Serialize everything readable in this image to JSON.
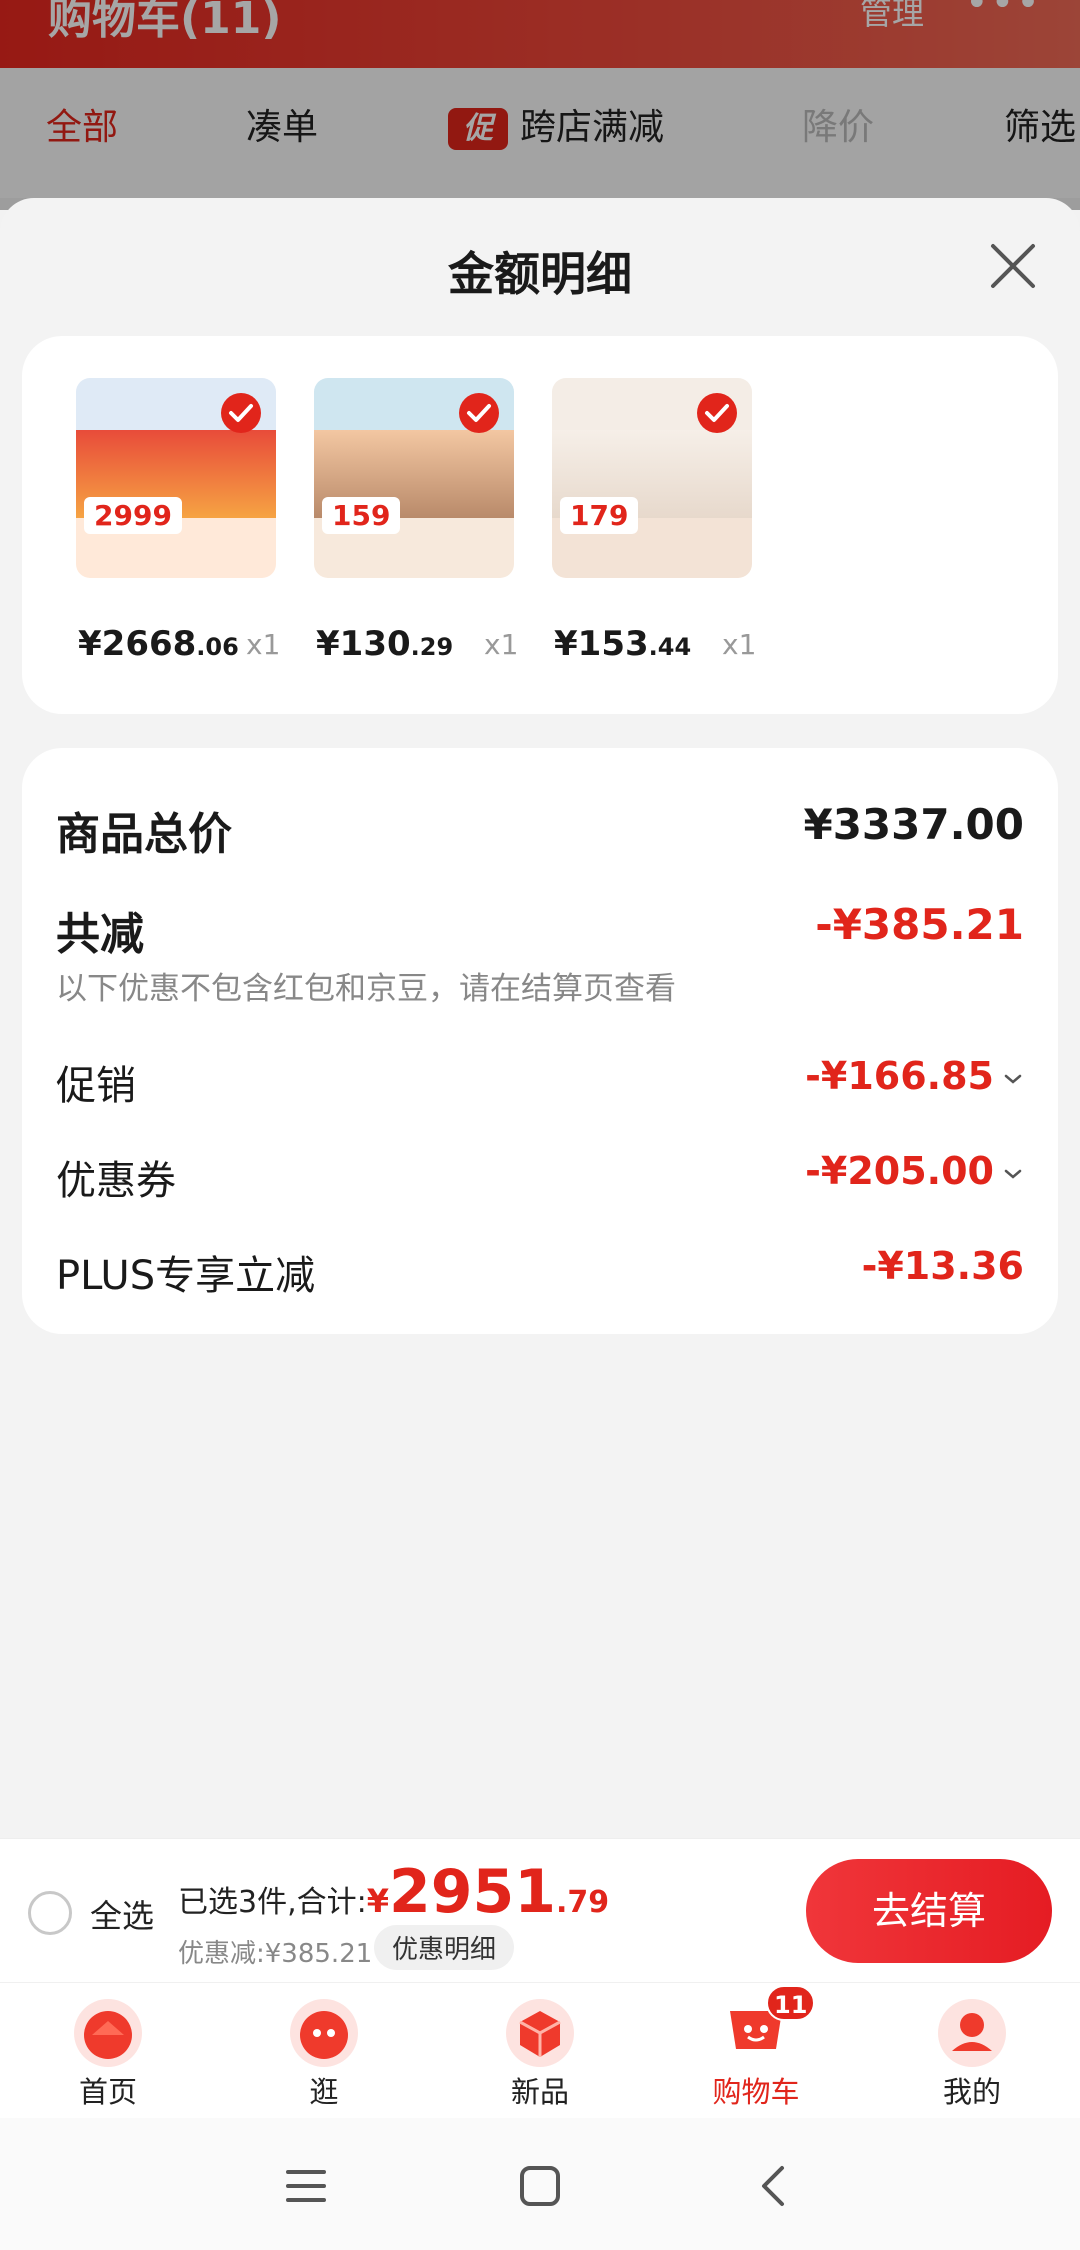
{
  "background": {
    "title": "购物车(11)",
    "manage": "管理",
    "tabs": [
      "全部",
      "凑单",
      "跨店满减",
      "降价",
      "筛选"
    ],
    "promo_badge": "促"
  },
  "sheet": {
    "title": "金额明细",
    "products": [
      {
        "thumb_label": "2999",
        "price_int": "¥2668",
        "price_dec": ".06",
        "qty": "x1"
      },
      {
        "thumb_label": "159",
        "price_int": "¥130",
        "price_dec": ".29",
        "qty": "x1"
      },
      {
        "thumb_label": "179",
        "price_int": "¥153",
        "price_dec": ".44",
        "qty": "x1"
      }
    ],
    "total_label": "商品总价",
    "total_value": "¥3337.00",
    "reduce_label": "共减",
    "reduce_value": "-¥385.21",
    "reduce_hint": "以下优惠不包含红包和京豆，请在结算页查看",
    "promo_label": "促销",
    "promo_value": "-¥166.85",
    "coupon_label": "优惠券",
    "coupon_value": "-¥205.00",
    "plus_label": "PLUS专享立减",
    "plus_value": "-¥13.36"
  },
  "checkout": {
    "select_all": "全选",
    "summary_prefix": "已选3件,合计:",
    "yen": "¥",
    "total_int": "2951",
    "total_dec": ".79",
    "discount_text": "优惠减:¥385.21",
    "detail_button": "优惠明细",
    "pay_button": "去结算"
  },
  "tabbar": {
    "items": [
      {
        "label": "首页"
      },
      {
        "label": "逛"
      },
      {
        "label": "新品"
      },
      {
        "label": "购物车",
        "badge": "11"
      },
      {
        "label": "我的"
      }
    ]
  },
  "colors": {
    "accent": "#e1251b",
    "background": "#f3f3f3"
  }
}
